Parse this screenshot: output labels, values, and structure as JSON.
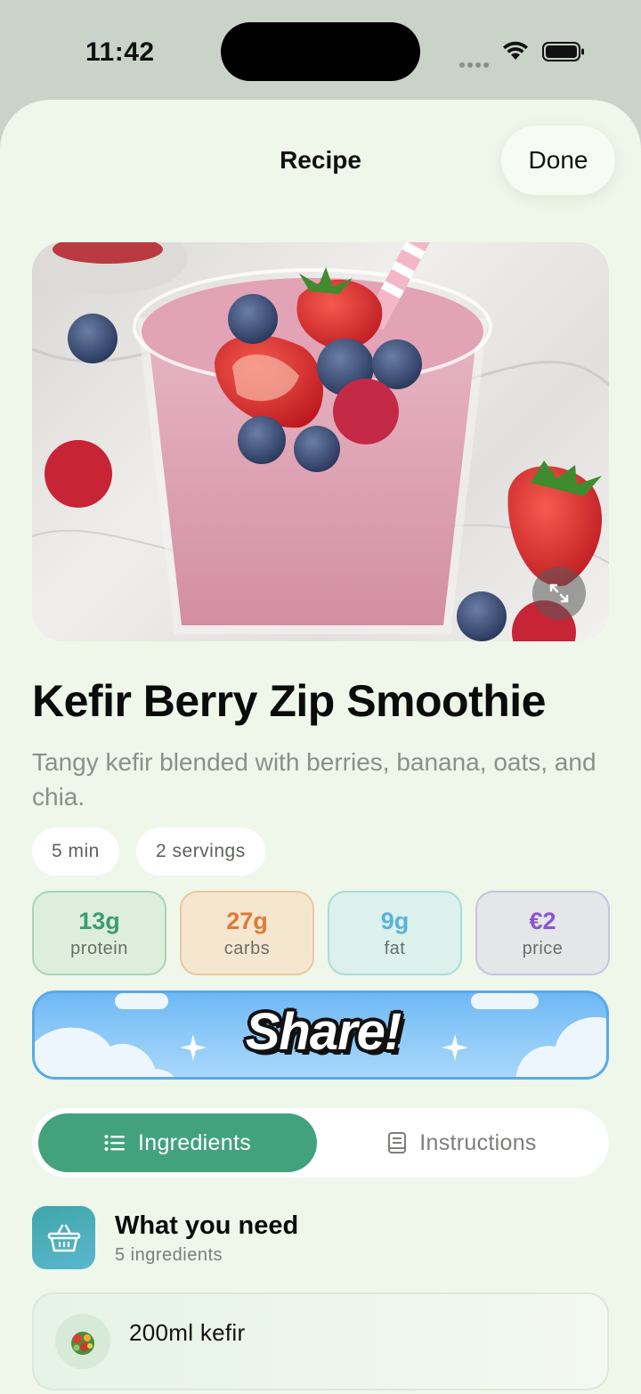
{
  "status_bar": {
    "time": "11:42",
    "icons": [
      "cellular-dots-icon",
      "wifi-icon",
      "battery-icon"
    ]
  },
  "header": {
    "title": "Recipe",
    "done_label": "Done"
  },
  "hero": {
    "image_description_icon": "smoothie-photo",
    "expand_icon": "expand-icon"
  },
  "recipe": {
    "title": "Kefir Berry Zip Smoothie",
    "description": "Tangy kefir blended with berries, banana, oats, and chia.",
    "chips": {
      "time": "5 min",
      "servings": "2 servings"
    },
    "macros": {
      "protein": {
        "value": "13g",
        "label": "protein",
        "color": "#3a9c72"
      },
      "carbs": {
        "value": "27g",
        "label": "carbs",
        "color": "#e07a34"
      },
      "fat": {
        "value": "9g",
        "label": "fat",
        "color": "#58b3da"
      },
      "price": {
        "value": "€2",
        "label": "price",
        "color": "#8a55d4"
      }
    }
  },
  "share": {
    "label": "Share!"
  },
  "tabs": {
    "ingredients": {
      "label": "Ingredients",
      "icon": "list-icon",
      "active": true
    },
    "instructions": {
      "label": "Instructions",
      "icon": "book-icon",
      "active": false
    }
  },
  "section": {
    "title": "What you need",
    "count": "5 ingredients",
    "icon": "basket-icon"
  },
  "ingredients": [
    {
      "name": "200ml kefir",
      "icon": "salad-icon"
    }
  ],
  "colors": {
    "accent": "#43a27e",
    "sheet_bg": "#eef7ea"
  }
}
